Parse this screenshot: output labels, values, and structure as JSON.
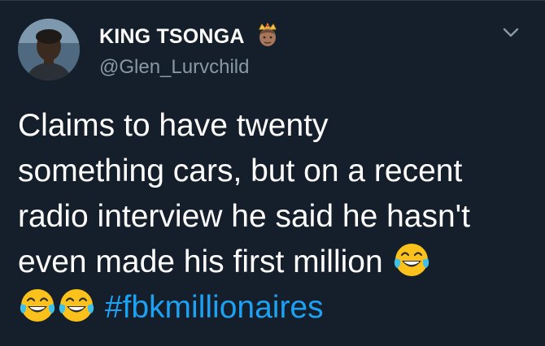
{
  "tweet": {
    "display_name": "KING TSONGA",
    "handle": "@Glen_Lurvchild",
    "text_line1": "Claims to have twenty",
    "text_line2": "something cars, but on a recent",
    "text_line3": "radio interview he said he hasn't",
    "text_line4": "even made his first million ",
    "hashtag": "#fbkmillionaires",
    "name_emoji": "crown-person-emoji",
    "reaction_emoji": "tears-of-joy-emoji"
  },
  "colors": {
    "background": "#151f2b",
    "text": "#ffffff",
    "secondary_text": "#8899a6",
    "link": "#1da1f2"
  }
}
